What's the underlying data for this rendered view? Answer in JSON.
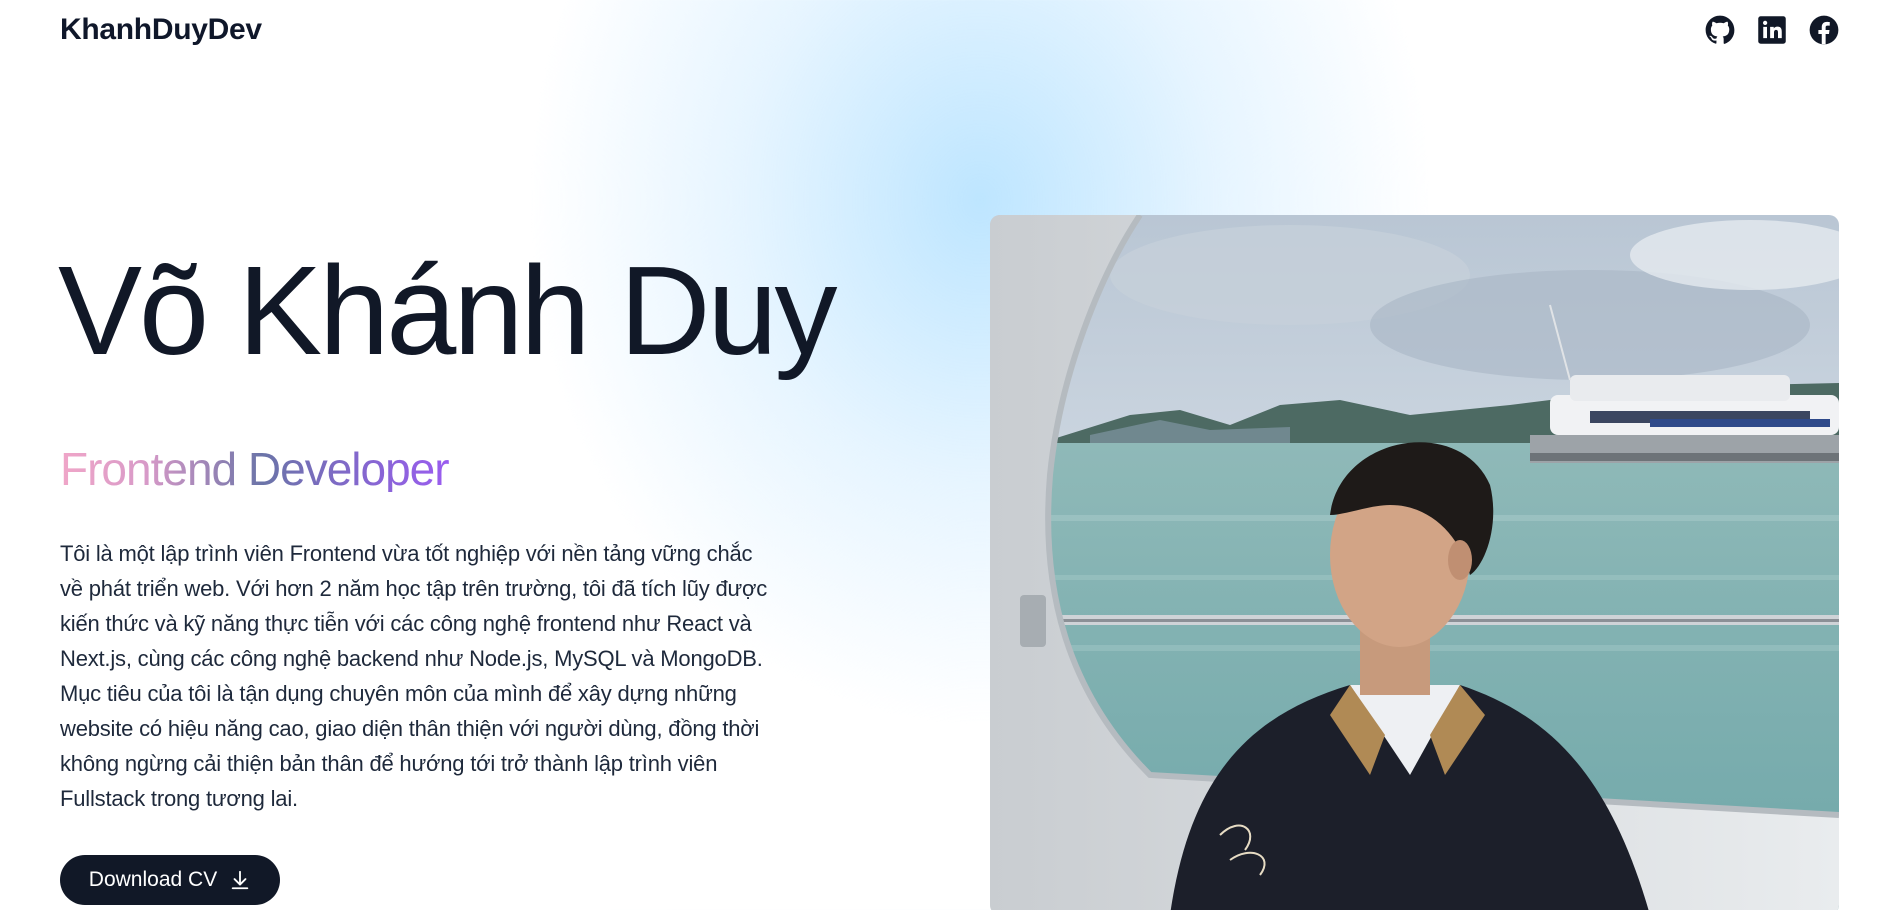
{
  "header": {
    "logo": "KhanhDuyDev",
    "socials": [
      {
        "icon": "github-icon"
      },
      {
        "icon": "linkedin-icon"
      },
      {
        "icon": "facebook-icon"
      }
    ]
  },
  "hero": {
    "name": "Võ Khánh Duy",
    "role": "Frontend Developer",
    "bio": "Tôi là một lập trình viên Frontend vừa tốt nghiệp với nền tảng vững chắc về phát triển web. Với hơn 2 năm học tập trên trường, tôi đã tích lũy được kiến thức và kỹ năng thực tiễn với các công nghệ frontend như React và Next.js, cùng các công nghệ backend như Node.js, MySQL và MongoDB. Mục tiêu của tôi là tận dụng chuyên môn của mình để xây dựng những website có hiệu năng cao, giao diện thân thiện với người dùng, đồng thời không ngừng cải thiện bản thân để hướng tới trở thành lập trình viên Fullstack trong tương lai.",
    "cv_button": "Download CV",
    "cv_icon": "download-icon"
  },
  "colors": {
    "text": "#111827",
    "button_bg": "#111827",
    "gradient_start": "#f0a6c8",
    "gradient_end": "#9a5cf0",
    "background_glow": "#bae4ff"
  }
}
